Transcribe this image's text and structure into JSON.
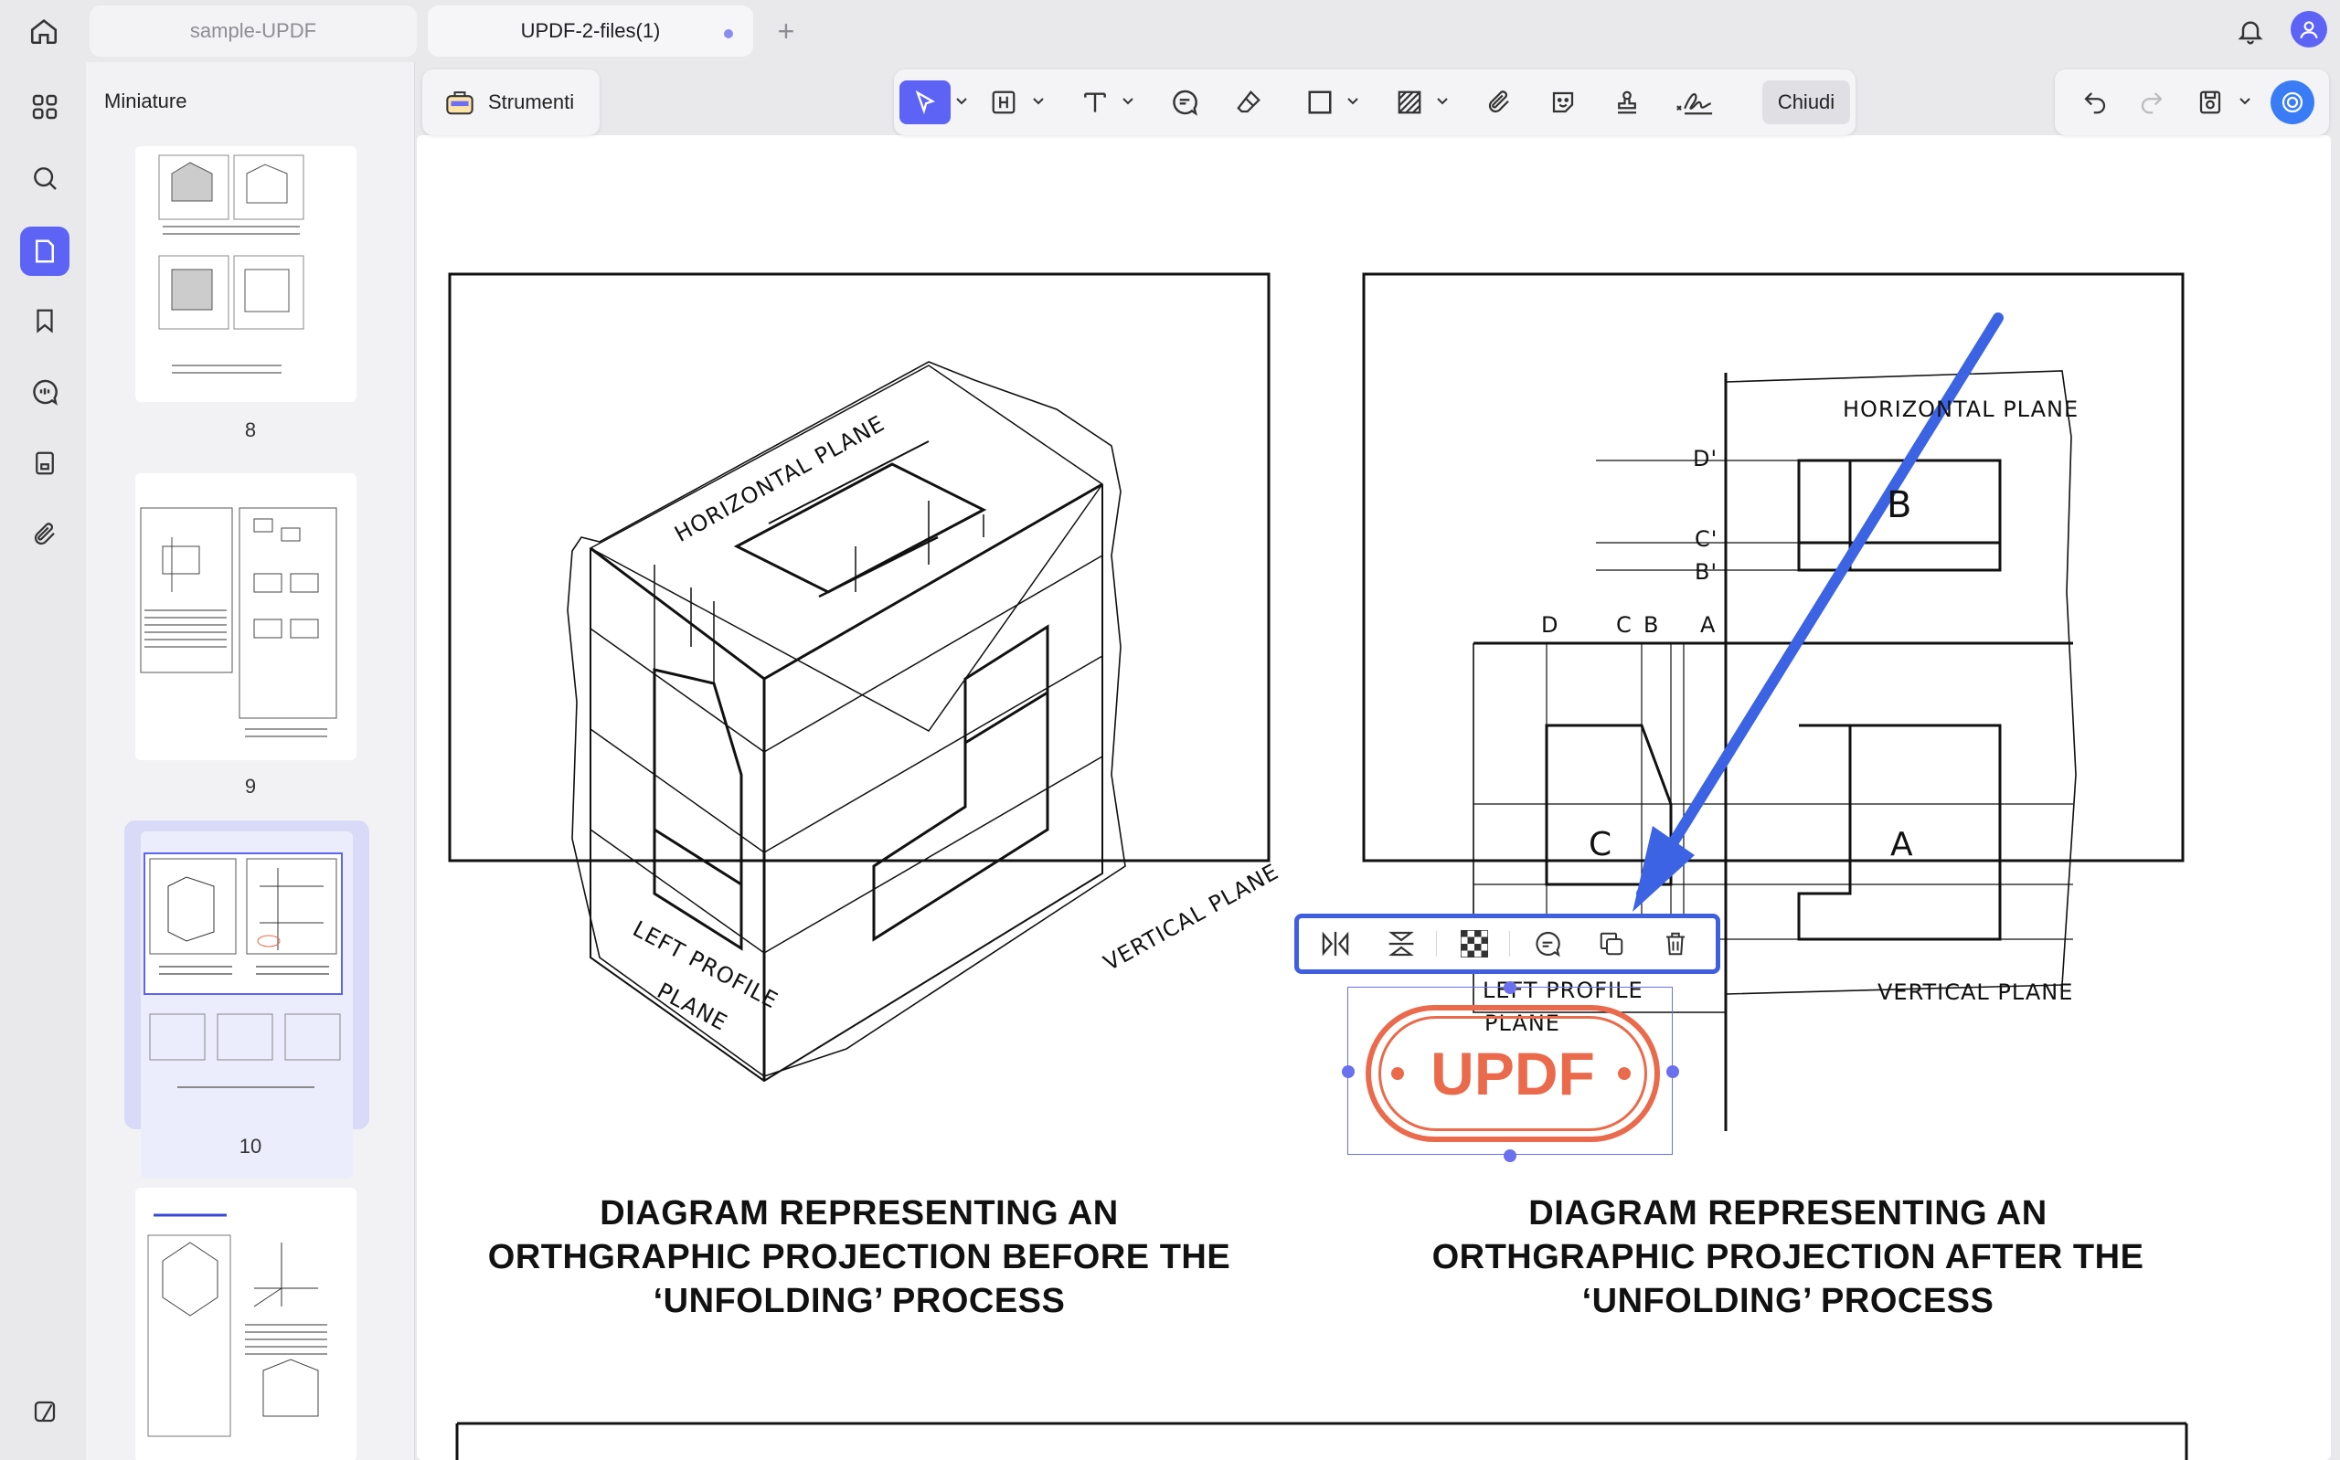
{
  "tabs": [
    {
      "label": "sample-UPDF",
      "active": false
    },
    {
      "label": "UPDF-2-files(1)",
      "active": true,
      "unsaved": true
    }
  ],
  "panel": {
    "title": "Miniature",
    "thumbnails": [
      {
        "page": "8"
      },
      {
        "page": "9"
      },
      {
        "page": "10",
        "selected": true
      },
      {
        "page": ""
      }
    ]
  },
  "toolbar": {
    "tools_label": "Strumenti",
    "close_label": "Chiudi"
  },
  "document": {
    "left_figure": {
      "caption_line1": "DIAGRAM REPRESENTING AN",
      "caption_line2": "ORTHGRAPHIC PROJECTION BEFORE THE",
      "caption_line3": "‘UNFOLDING’ PROCESS",
      "label_horizontal": "HORIZONTAL PLANE",
      "label_vertical": "VERTICAL PLANE",
      "label_left1": "LEFT PROFILE",
      "label_left2": "PLANE"
    },
    "right_figure": {
      "caption_line1": "DIAGRAM REPRESENTING AN",
      "caption_line2": "ORTHGRAPHIC PROJECTION AFTER THE",
      "caption_line3": "‘UNFOLDING’ PROCESS",
      "label_horizontal": "HORIZONTAL PLANE",
      "label_vertical": "VERTICAL PLANE",
      "label_left1": "LEFT PROFILE",
      "label_left2": "PLANE",
      "letters": {
        "d_prime": "D'",
        "c_prime": "C'",
        "b_prime": "B'",
        "d": "D",
        "c": "C",
        "b": "B",
        "a": "A",
        "face_b": "B",
        "face_c": "C",
        "face_a": "A"
      }
    }
  },
  "stamp": {
    "text": "UPDF",
    "color": "#ea6a4b"
  },
  "colors": {
    "accent": "#5d64f5",
    "arrow": "#3b63e3",
    "context_border": "#3f5fe0"
  }
}
